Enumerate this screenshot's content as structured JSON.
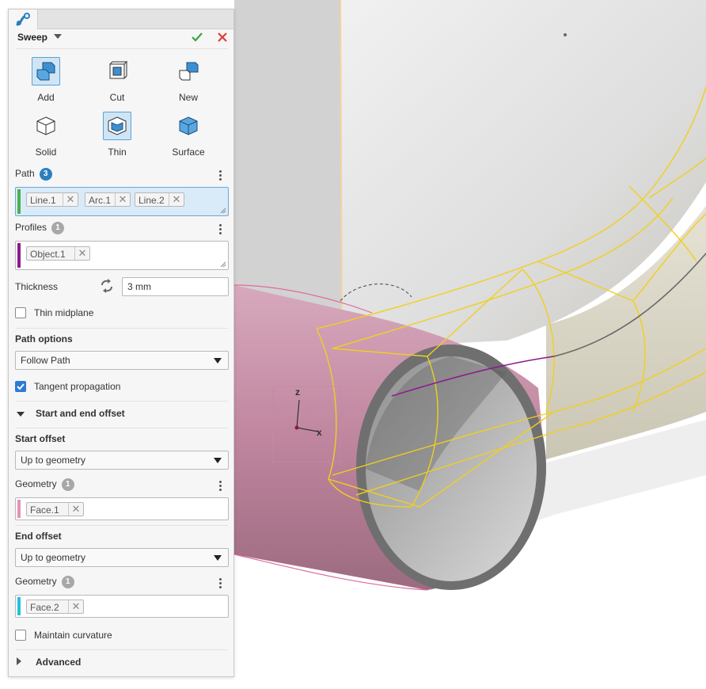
{
  "panel": {
    "title": "Sweep",
    "operation_options": [
      {
        "label": "Add",
        "icon": "add-solid-icon",
        "selected": true
      },
      {
        "label": "Cut",
        "icon": "cut-solid-icon",
        "selected": false
      },
      {
        "label": "New",
        "icon": "new-body-icon",
        "selected": false
      }
    ],
    "body_options": [
      {
        "label": "Solid",
        "icon": "solid-body-icon",
        "selected": false
      },
      {
        "label": "Thin",
        "icon": "thin-body-icon",
        "selected": true
      },
      {
        "label": "Surface",
        "icon": "surface-body-icon",
        "selected": false
      }
    ],
    "path": {
      "label": "Path",
      "count": "3",
      "items": [
        "Line.1",
        "Arc.1",
        "Line.2"
      ],
      "color": "#4caf50"
    },
    "profiles": {
      "label": "Profiles",
      "count": "1",
      "items": [
        "Object.1"
      ],
      "color": "#8b1a8f"
    },
    "thickness": {
      "label": "Thickness",
      "value": "3 mm"
    },
    "thin_midplane": {
      "label": "Thin midplane",
      "checked": false
    },
    "path_options": {
      "label": "Path options",
      "selected": "Follow Path"
    },
    "tangent_propagation": {
      "label": "Tangent propagation",
      "checked": true
    },
    "start_end_offset": {
      "label": "Start and end offset",
      "expanded": true
    },
    "start_offset": {
      "label": "Start offset",
      "selected": "Up to geometry",
      "geometry_label": "Geometry",
      "count": "1",
      "items": [
        "Face.1"
      ],
      "color": "#e991b6"
    },
    "end_offset": {
      "label": "End offset",
      "selected": "Up to geometry",
      "geometry_label": "Geometry",
      "count": "1",
      "items": [
        "Face.2"
      ],
      "color": "#22c1e0"
    },
    "maintain_curvature": {
      "label": "Maintain curvature",
      "checked": false
    },
    "advanced": {
      "label": "Advanced",
      "expanded": false
    }
  },
  "viewport": {
    "axis_labels": {
      "z": "z",
      "x": "x"
    }
  },
  "colors": {
    "accent": "#2a7fc0",
    "ok": "#3aa53a",
    "cancel": "#e23b3b",
    "wireframe": "#f2cf1d",
    "pipe": "#c98aa5"
  }
}
